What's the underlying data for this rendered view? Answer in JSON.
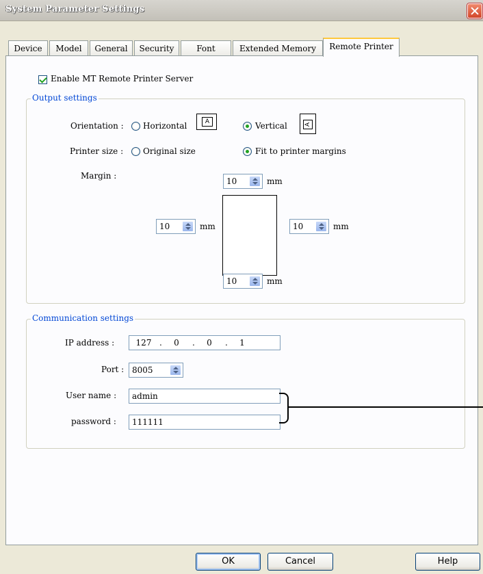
{
  "window": {
    "title": "System Parameter Settings"
  },
  "tabs": [
    "Device",
    "Model",
    "General",
    "Security",
    "Font",
    "Extended Memory",
    "Remote Printer"
  ],
  "enable_server": {
    "label": "Enable MT Remote Printer Server",
    "checked": true
  },
  "output_settings": {
    "legend": "Output settings",
    "orientation": {
      "label": "Orientation :",
      "options": [
        "Horizontal",
        "Vertical"
      ],
      "selected": "Vertical",
      "horizontal_icon": "A",
      "vertical_icon": "A"
    },
    "printer_size": {
      "label": "Printer size :",
      "options": [
        "Original size",
        "Fit to printer margins"
      ],
      "selected": "Fit to printer margins"
    },
    "margin": {
      "label": "Margin :",
      "top": "10",
      "left": "10",
      "right": "10",
      "bottom": "10",
      "unit": "mm"
    }
  },
  "communication_settings": {
    "legend": "Communication settings",
    "ip_label": "IP address :",
    "ip": [
      "127",
      "0",
      "0",
      "1"
    ],
    "ip_dot": ".",
    "port_label": "Port :",
    "port": "8005",
    "username_label": "User name :",
    "username": "admin",
    "password_label": "password :",
    "password": "111111"
  },
  "buttons": {
    "ok": "OK",
    "cancel": "Cancel",
    "help": "Help"
  }
}
